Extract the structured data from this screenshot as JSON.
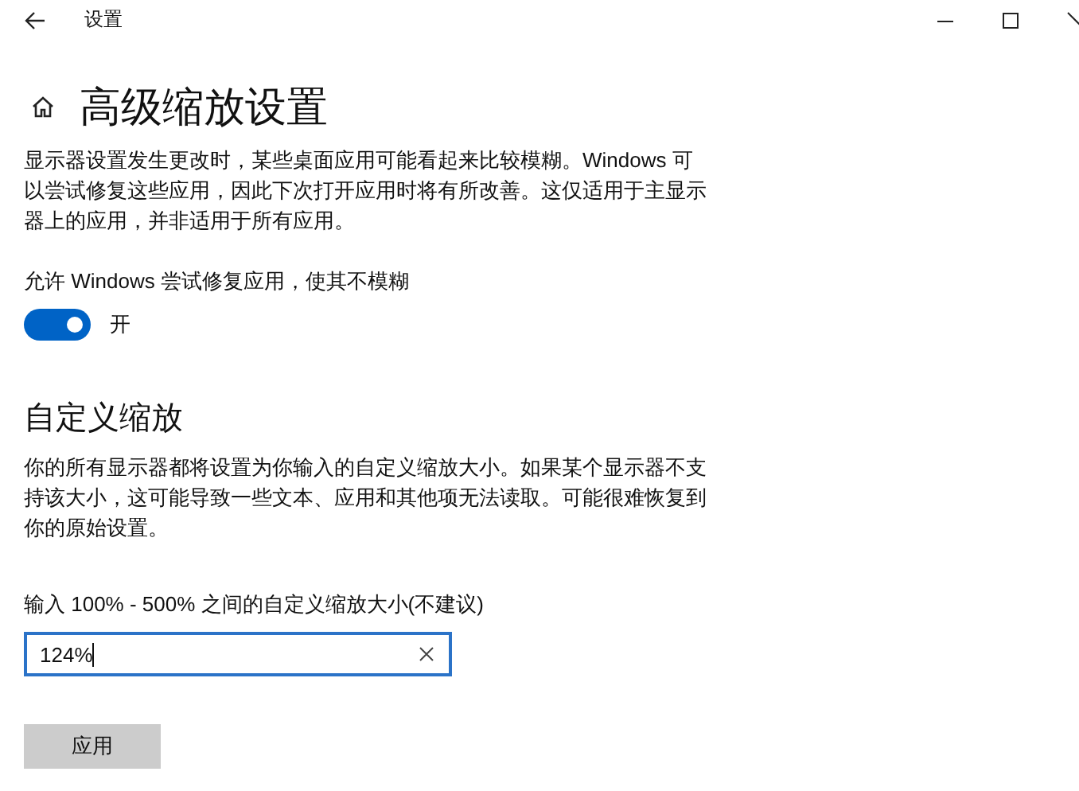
{
  "window": {
    "title": "设置"
  },
  "page": {
    "title": "高级缩放设置",
    "description": "显示器设置发生更改时，某些桌面应用可能看起来比较模糊。Windows 可以尝试修复这些应用，因此下次打开应用时将有所改善。这仅适用于主显示器上的应用，并非适用于所有应用。"
  },
  "fix_apps": {
    "label": "允许 Windows 尝试修复应用，使其不模糊",
    "on": true,
    "state_text": "开"
  },
  "custom_scaling": {
    "heading": "自定义缩放",
    "description": "你的所有显示器都将设置为你输入的自定义缩放大小。如果某个显示器不支持该大小，这可能导致一些文本、应用和其他项无法读取。可能很难恢复到你的原始设置。",
    "field_label": "输入 100% - 500% 之间的自定义缩放大小(不建议)",
    "value": "124%",
    "apply_button": "应用"
  }
}
